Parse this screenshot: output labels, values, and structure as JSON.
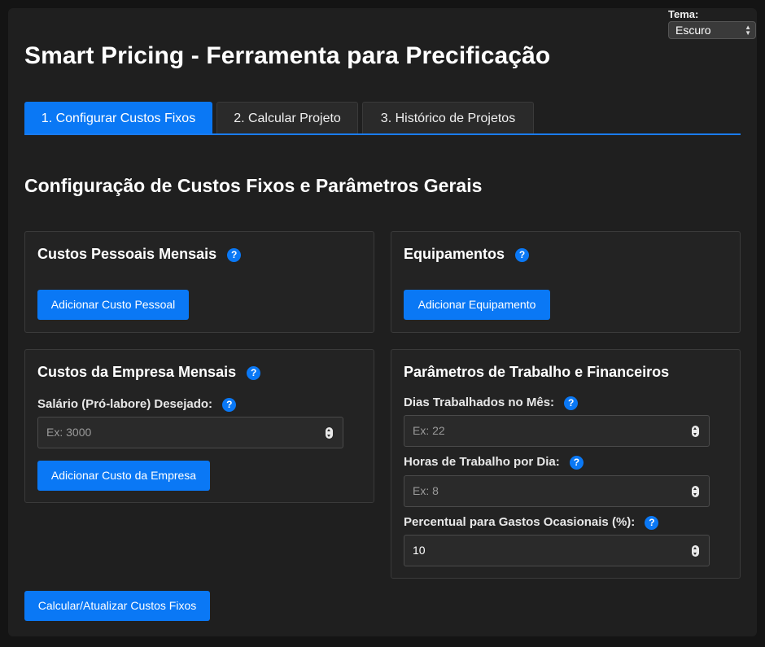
{
  "theme": {
    "label": "Tema:",
    "selected": "Escuro"
  },
  "header": {
    "title": "Smart Pricing - Ferramenta para Precificação"
  },
  "tabs": [
    {
      "label": "1. Configurar Custos Fixos",
      "active": true
    },
    {
      "label": "2. Calcular Projeto",
      "active": false
    },
    {
      "label": "3. Histórico de Projetos",
      "active": false
    }
  ],
  "section": {
    "title": "Configuração de Custos Fixos e Parâmetros Gerais"
  },
  "help_glyph": "?",
  "personal_costs": {
    "title": "Custos Pessoais Mensais",
    "button": "Adicionar Custo Pessoal"
  },
  "equipment": {
    "title": "Equipamentos",
    "button": "Adicionar Equipamento"
  },
  "company_costs": {
    "title": "Custos da Empresa Mensais",
    "salary_label": "Salário (Pró-labore) Desejado:",
    "salary_placeholder": "Ex: 3000",
    "button": "Adicionar Custo da Empresa"
  },
  "parameters": {
    "title": "Parâmetros de Trabalho e Financeiros",
    "days_label": "Dias Trabalhados no Mês:",
    "days_placeholder": "Ex: 22",
    "hours_label": "Horas de Trabalho por Dia:",
    "hours_placeholder": "Ex: 8",
    "occasional_label": "Percentual para Gastos Ocasionais (%):",
    "occasional_value": "10"
  },
  "footer": {
    "calculate_button": "Calcular/Atualizar Custos Fixos"
  },
  "colors": {
    "accent": "#0a78f5",
    "background": "#1f1f1f",
    "card": "#232323"
  },
  "icons": {
    "help": "help-icon",
    "stepper": "stepper-icon",
    "select_arrows": "select-arrows-icon"
  }
}
